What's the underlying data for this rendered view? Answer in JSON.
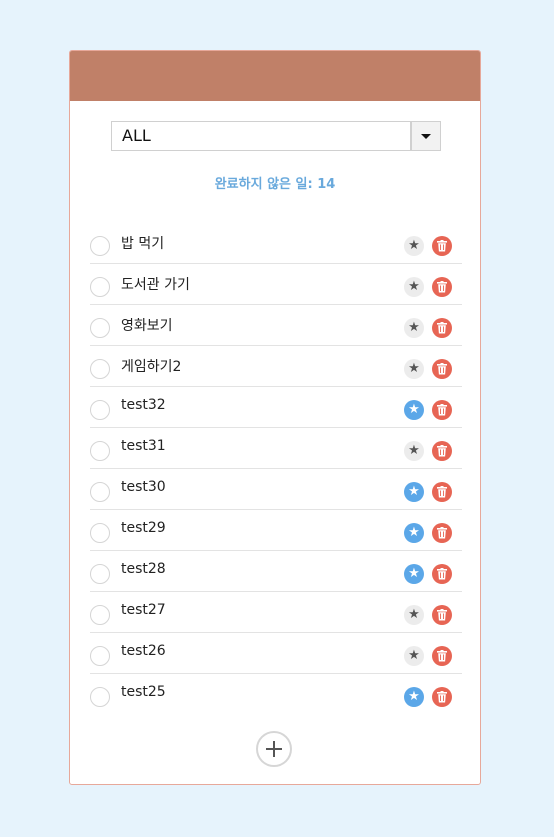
{
  "filter": {
    "selected": "ALL"
  },
  "remaining_text": "완료하지 않은 일: 14",
  "todos": [
    {
      "text": "밥 먹기",
      "starred": false
    },
    {
      "text": "도서관 가기",
      "starred": false
    },
    {
      "text": "영화보기",
      "starred": false
    },
    {
      "text": "게임하기2",
      "starred": false
    },
    {
      "text": "test32",
      "starred": true
    },
    {
      "text": "test31",
      "starred": false
    },
    {
      "text": "test30",
      "starred": true
    },
    {
      "text": "test29",
      "starred": true
    },
    {
      "text": "test28",
      "starred": true
    },
    {
      "text": "test27",
      "starred": false
    },
    {
      "text": "test26",
      "starred": false
    },
    {
      "text": "test25",
      "starred": true
    }
  ],
  "icons": {
    "star": "star-icon",
    "trash": "trash-icon",
    "add": "plus-icon",
    "dropdown": "chevron-down-icon",
    "checkbox": "circle-checkbox-icon"
  },
  "colors": {
    "background": "#e6f3fc",
    "header": "#c08068",
    "accent_text": "#69a9dc",
    "star_active": "#5ba7e8",
    "star_inactive": "#ececec",
    "delete": "#e76554"
  }
}
